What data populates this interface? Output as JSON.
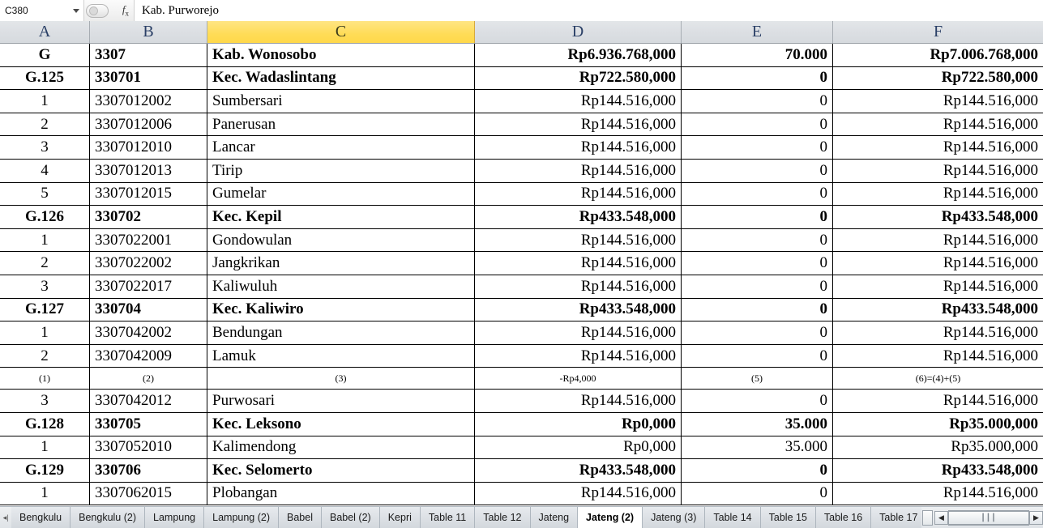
{
  "formula_bar": {
    "name_box_value": "C380",
    "fx_label": "fx",
    "formula_value": "Kab. Purworejo",
    "caret_icon": "chevron-down-icon"
  },
  "columns": [
    {
      "id": "A",
      "label": "A",
      "selected": false
    },
    {
      "id": "B",
      "label": "B",
      "selected": false
    },
    {
      "id": "C",
      "label": "C",
      "selected": true
    },
    {
      "id": "D",
      "label": "D",
      "selected": false
    },
    {
      "id": "E",
      "label": "E",
      "selected": false
    },
    {
      "id": "F",
      "label": "F",
      "selected": false
    }
  ],
  "selected_column_color": "#FFD94D",
  "header_color": "#DCDFE3",
  "rows": [
    {
      "style": "bold",
      "a": "G",
      "b": "3307",
      "c": "Kab. Wonosobo",
      "d": "Rp6.936.768,000",
      "e": "70.000",
      "f": "Rp7.006.768,000"
    },
    {
      "style": "bold",
      "a": "G.125",
      "b": "330701",
      "c": "Kec. Wadaslintang",
      "d": "Rp722.580,000",
      "e": "0",
      "f": "Rp722.580,000"
    },
    {
      "style": "normal",
      "a": "1",
      "b": "3307012002",
      "c": "Sumbersari",
      "d": "Rp144.516,000",
      "e": "0",
      "f": "Rp144.516,000"
    },
    {
      "style": "normal",
      "a": "2",
      "b": "3307012006",
      "c": "Panerusan",
      "d": "Rp144.516,000",
      "e": "0",
      "f": "Rp144.516,000"
    },
    {
      "style": "normal",
      "a": "3",
      "b": "3307012010",
      "c": "Lancar",
      "d": "Rp144.516,000",
      "e": "0",
      "f": "Rp144.516,000"
    },
    {
      "style": "normal",
      "a": "4",
      "b": "3307012013",
      "c": "Tirip",
      "d": "Rp144.516,000",
      "e": "0",
      "f": "Rp144.516,000"
    },
    {
      "style": "normal",
      "a": "5",
      "b": "3307012015",
      "c": "Gumelar",
      "d": "Rp144.516,000",
      "e": "0",
      "f": "Rp144.516,000"
    },
    {
      "style": "bold",
      "a": "G.126",
      "b": "330702",
      "c": "Kec. Kepil",
      "d": "Rp433.548,000",
      "e": "0",
      "f": "Rp433.548,000"
    },
    {
      "style": "normal",
      "a": "1",
      "b": "3307022001",
      "c": "Gondowulan",
      "d": "Rp144.516,000",
      "e": "0",
      "f": "Rp144.516,000"
    },
    {
      "style": "normal",
      "a": "2",
      "b": "3307022002",
      "c": "Jangkrikan",
      "d": "Rp144.516,000",
      "e": "0",
      "f": "Rp144.516,000"
    },
    {
      "style": "normal",
      "a": "3",
      "b": "3307022017",
      "c": "Kaliwuluh",
      "d": "Rp144.516,000",
      "e": "0",
      "f": "Rp144.516,000"
    },
    {
      "style": "bold",
      "a": "G.127",
      "b": "330704",
      "c": "Kec. Kaliwiro",
      "d": "Rp433.548,000",
      "e": "0",
      "f": "Rp433.548,000"
    },
    {
      "style": "normal",
      "a": "1",
      "b": "3307042002",
      "c": "Bendungan",
      "d": "Rp144.516,000",
      "e": "0",
      "f": "Rp144.516,000"
    },
    {
      "style": "normal",
      "a": "2",
      "b": "3307042009",
      "c": "Lamuk",
      "d": "Rp144.516,000",
      "e": "0",
      "f": "Rp144.516,000"
    },
    {
      "style": "note",
      "a": "(1)",
      "b": "(2)",
      "c": "(3)",
      "d": "-Rp4,000",
      "e": "(5)",
      "f": "(6)=(4)+(5)"
    },
    {
      "style": "normal",
      "a": "3",
      "b": "3307042012",
      "c": "Purwosari",
      "d": "Rp144.516,000",
      "e": "0",
      "f": "Rp144.516,000"
    },
    {
      "style": "bold",
      "a": "G.128",
      "b": "330705",
      "c": "Kec. Leksono",
      "d": "Rp0,000",
      "e": "35.000",
      "f": "Rp35.000,000"
    },
    {
      "style": "normal",
      "a": "1",
      "b": "3307052010",
      "c": "Kalimendong",
      "d": "Rp0,000",
      "e": "35.000",
      "f": "Rp35.000,000"
    },
    {
      "style": "bold",
      "a": "G.129",
      "b": "330706",
      "c": "Kec. Selomerto",
      "d": "Rp433.548,000",
      "e": "0",
      "f": "Rp433.548,000"
    },
    {
      "style": "normal",
      "a": "1",
      "b": "3307062015",
      "c": "Plobangan",
      "d": "Rp144.516,000",
      "e": "0",
      "f": "Rp144.516,000"
    }
  ],
  "sheet_tabs": {
    "items": [
      {
        "label": "Bengkulu",
        "active": false
      },
      {
        "label": "Bengkulu (2)",
        "active": false
      },
      {
        "label": "Lampung",
        "active": false
      },
      {
        "label": "Lampung (2)",
        "active": false
      },
      {
        "label": "Babel",
        "active": false
      },
      {
        "label": "Babel (2)",
        "active": false
      },
      {
        "label": "Kepri",
        "active": false
      },
      {
        "label": "Table 11",
        "active": false
      },
      {
        "label": "Table 12",
        "active": false
      },
      {
        "label": "Jateng",
        "active": false
      },
      {
        "label": "Jateng (2)",
        "active": true
      },
      {
        "label": "Jateng (3)",
        "active": false
      },
      {
        "label": "Table 14",
        "active": false
      },
      {
        "label": "Table 15",
        "active": false
      },
      {
        "label": "Table 16",
        "active": false
      },
      {
        "label": "Table 17",
        "active": false
      }
    ],
    "nav_prev_icon": "tab-nav-prev-icon",
    "scroll_left_icon": "◀",
    "scroll_right_icon": "▶",
    "scroll_thumb_grip": "┃┃┃"
  }
}
